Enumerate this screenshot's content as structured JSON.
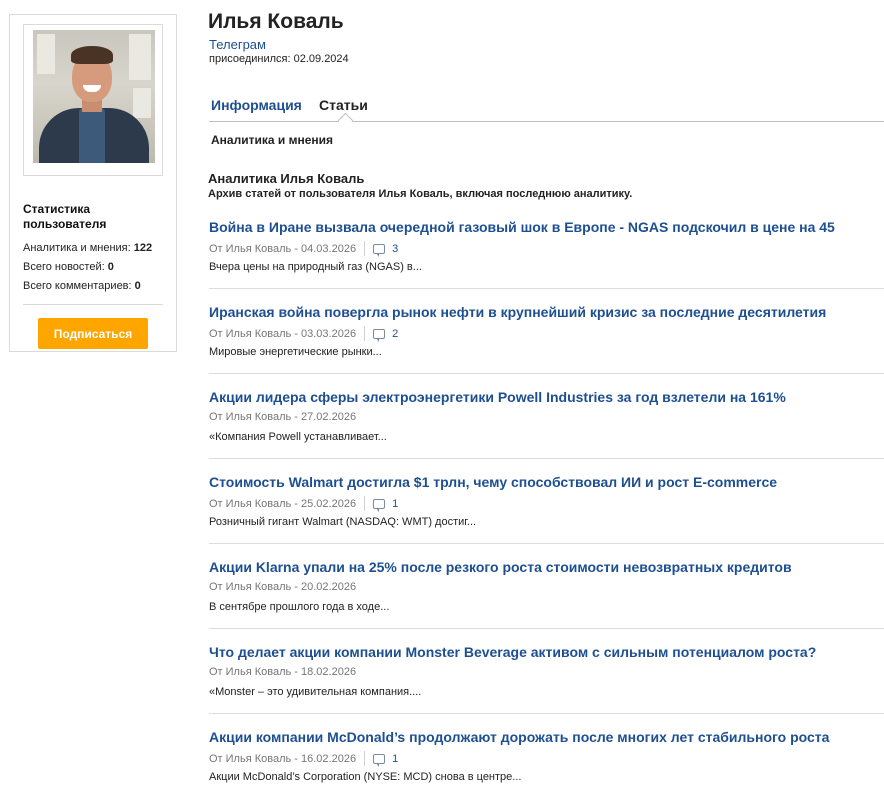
{
  "profile": {
    "name": "Илья Коваль",
    "source": "Телеграм",
    "joined": "присоединился: 02.09.2024"
  },
  "sidebar": {
    "stats_title": "Статистика пользователя",
    "stats": [
      {
        "label": "Аналитика и мнения:",
        "value": "122"
      },
      {
        "label": "Всего новостей:",
        "value": "0"
      },
      {
        "label": "Всего комментариев:",
        "value": "0"
      }
    ],
    "subscribe_label": "Подписаться"
  },
  "tabs": [
    {
      "label": "Информация",
      "active": false
    },
    {
      "label": "Статьи",
      "active": true
    }
  ],
  "subtab": "Аналитика и мнения",
  "section": {
    "title": "Аналитика Илья Коваль",
    "description": "Архив статей от пользователя Илья Коваль, включая последнюю аналитику."
  },
  "articles": [
    {
      "title": "Война в Иране вызвала очередной газовый шок в Европе - NGAS подскочил в цене на 45",
      "meta": "От Илья Коваль - 04.03.2026",
      "comments": "3",
      "excerpt": "Вчера цены на природный газ (NGAS) в..."
    },
    {
      "title": "Иранская война повергла рынок нефти в крупнейший кризис за последние десятилетия",
      "meta": "От Илья Коваль - 03.03.2026",
      "comments": "2",
      "excerpt": "Мировые энергетические рынки..."
    },
    {
      "title": "Акции лидера сферы электроэнергетики Powell Industries за год взлетели на 161%",
      "meta": "От Илья Коваль - 27.02.2026",
      "comments": "",
      "excerpt": "«Компания Powell устанавливает..."
    },
    {
      "title": "Стоимость Walmart достигла $1 трлн, чему способствовал ИИ и рост E-commerce",
      "meta": "От Илья Коваль - 25.02.2026",
      "comments": "1",
      "excerpt": "Розничный гигант Walmart (NASDAQ: WMT) достиг..."
    },
    {
      "title": "Акции Klarna упали на 25% после резкого роста стоимости невозвратных кредитов",
      "meta": "От Илья Коваль - 20.02.2026",
      "comments": "",
      "excerpt": "В сентябре прошлого года в ходе..."
    },
    {
      "title": "Что делает акции компании Monster Beverage активом с сильным потенциалом роста?",
      "meta": "От Илья Коваль - 18.02.2026",
      "comments": "",
      "excerpt": "«Monster – это удивительная компания...."
    },
    {
      "title": "Акции компании McDonald’s продолжают дорожать после многих лет стабильного роста",
      "meta": "От Илья Коваль - 16.02.2026",
      "comments": "1",
      "excerpt": "Акции McDonald’s Corporation (NYSE: MCD) снова в центре..."
    }
  ],
  "colors": {
    "link": "#1d4f91",
    "subscribe": "#ffa500"
  },
  "icons": {
    "comment": "comment-bubble-icon"
  }
}
